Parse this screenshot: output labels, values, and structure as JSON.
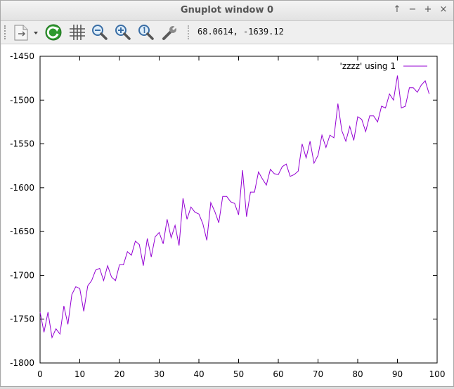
{
  "window": {
    "title": "Gnuplot window 0",
    "controls": [
      "↑",
      "−",
      "+",
      "×"
    ]
  },
  "toolbar": {
    "coords": "68.0614, -1639.12"
  },
  "chart_data": {
    "type": "line",
    "xlim": [
      0,
      100
    ],
    "ylim": [
      -1800,
      -1450
    ],
    "x_ticks": [
      "0",
      "10",
      "20",
      "30",
      "40",
      "50",
      "60",
      "70",
      "80",
      "90",
      "100"
    ],
    "y_ticks": [
      "-1450",
      "-1500",
      "-1550",
      "-1600",
      "-1650",
      "-1700",
      "-1750",
      "-1800"
    ],
    "grid": false,
    "legend_position": "top-right",
    "series": [
      {
        "name": "'zzzz' using 1",
        "color": "#9400d3",
        "values": [
          -1742,
          -1765,
          -1742,
          -1771,
          -1761,
          -1767,
          -1735,
          -1756,
          -1722,
          -1713,
          -1715,
          -1741,
          -1712,
          -1706,
          -1694,
          -1692,
          -1706,
          -1689,
          -1702,
          -1706,
          -1688,
          -1688,
          -1673,
          -1677,
          -1661,
          -1665,
          -1689,
          -1658,
          -1679,
          -1656,
          -1651,
          -1664,
          -1636,
          -1657,
          -1643,
          -1666,
          -1612,
          -1636,
          -1622,
          -1628,
          -1630,
          -1641,
          -1660,
          -1617,
          -1627,
          -1640,
          -1610,
          -1610,
          -1616,
          -1618,
          -1631,
          -1580,
          -1633,
          -1605,
          -1605,
          -1582,
          -1590,
          -1597,
          -1579,
          -1584,
          -1585,
          -1576,
          -1573,
          -1587,
          -1585,
          -1581,
          -1550,
          -1566,
          -1547,
          -1572,
          -1563,
          -1540,
          -1554,
          -1540,
          -1543,
          -1504,
          -1535,
          -1547,
          -1530,
          -1546,
          -1519,
          -1522,
          -1536,
          -1518,
          -1518,
          -1525,
          -1507,
          -1509,
          -1493,
          -1500,
          -1472,
          -1509,
          -1507,
          -1486,
          -1486,
          -1491,
          -1483,
          -1478,
          -1493
        ]
      }
    ]
  }
}
